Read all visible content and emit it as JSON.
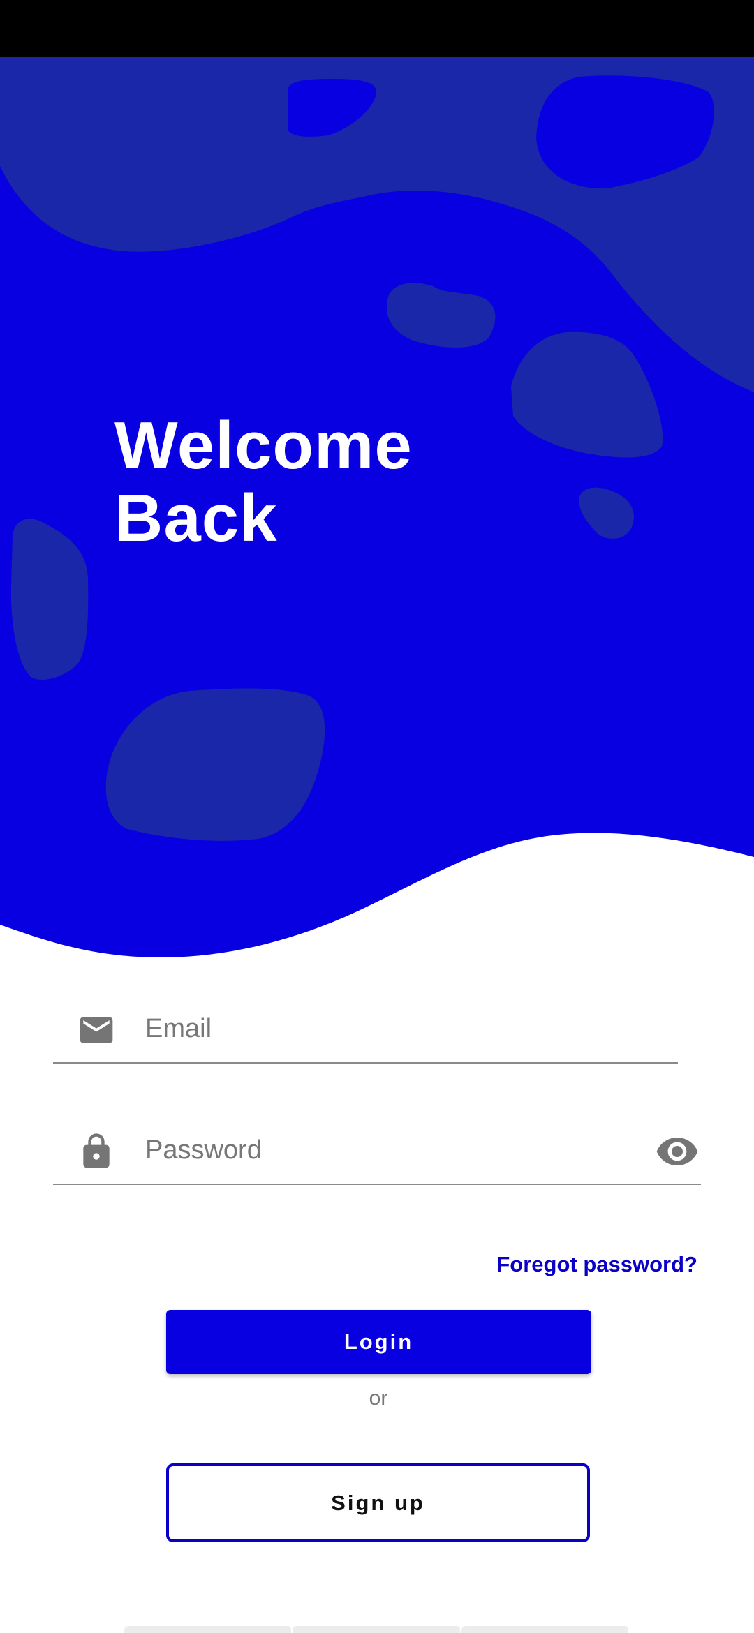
{
  "hero": {
    "title_line1": "Welcome",
    "title_line2": "Back"
  },
  "form": {
    "email_placeholder": "Email",
    "email_value": "",
    "password_placeholder": "Password",
    "password_value": "",
    "forgot_password": "Foregot password?",
    "login_label": "Login",
    "or_label": "or",
    "signup_label": "Sign up"
  },
  "icons": {
    "email": "mail-icon",
    "password": "lock-icon",
    "visibility": "eye-icon"
  },
  "colors": {
    "primary": "#0800e0",
    "primary_dark": "#0a00c8",
    "blob": "#1a27a8",
    "hint": "#777777"
  }
}
